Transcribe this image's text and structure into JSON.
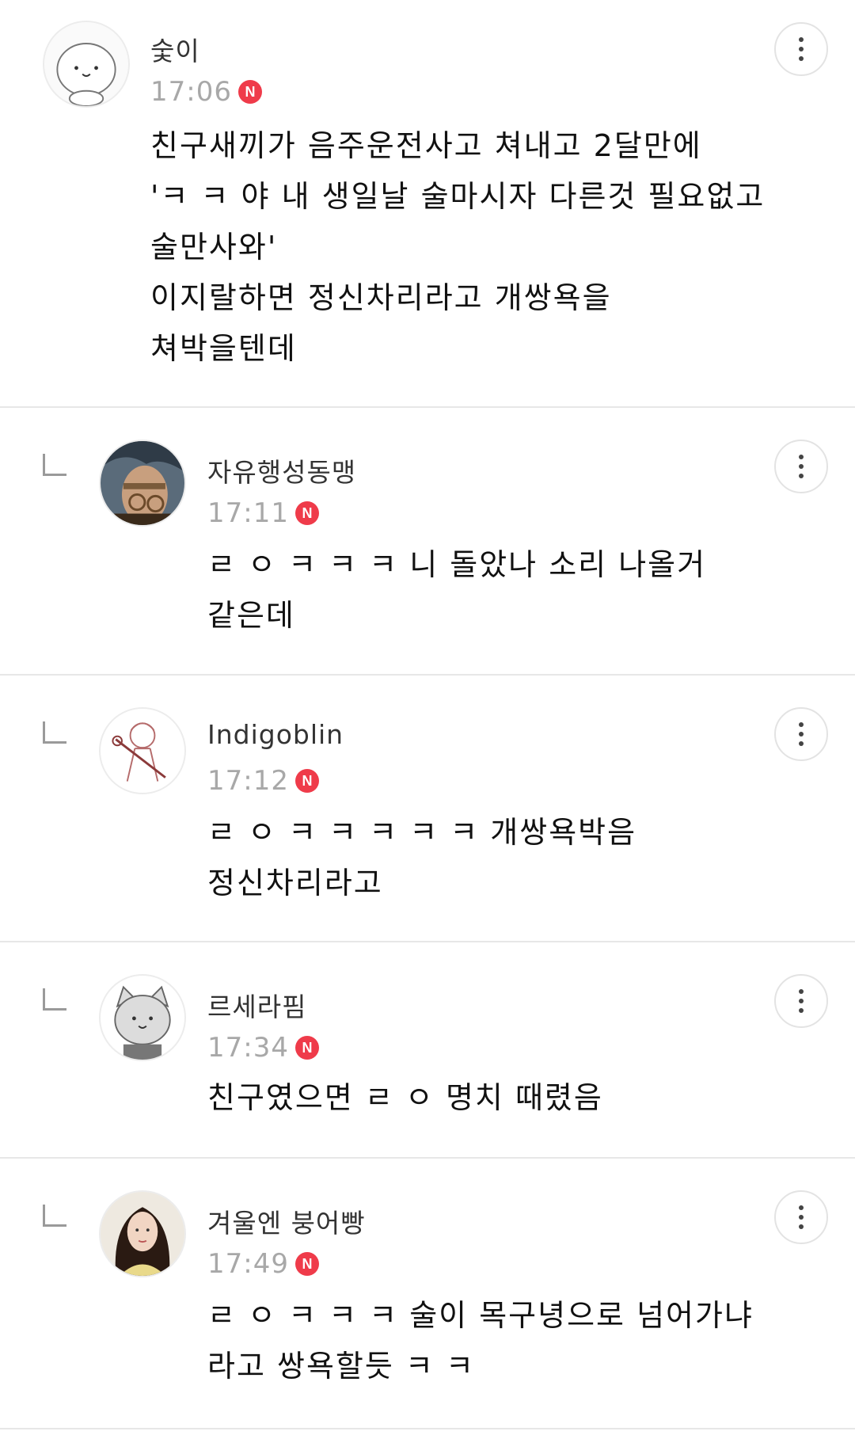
{
  "comments": [
    {
      "author": "숯이",
      "time": "17:06",
      "badge": "N",
      "avatar_icon": "cat-face-avatar",
      "lines": [
        "친구새끼가 음주운전사고 쳐내고 2달만에",
        "'ㅋ ㅋ 야 내 생일날 술마시자 다른것 필요없고",
        "술만사와'",
        "이지랄하면 정신차리라고 개쌍욕을",
        "쳐박을텐데"
      ]
    },
    {
      "author": "자유행성동맹",
      "time": "17:11",
      "badge": "N",
      "avatar_icon": "warrior-portrait-avatar",
      "lines": [
        "ㄹ ㅇ ㅋ ㅋ ㅋ 니 돌았나 소리 나올거",
        "같은데"
      ]
    },
    {
      "author": "Indigoblin",
      "time": "17:12",
      "badge": "N",
      "avatar_icon": "sketch-character-avatar",
      "lines": [
        "ㄹ ㅇ ㅋ ㅋ ㅋ ㅋ ㅋ 개쌍욕박음",
        "정신차리라고"
      ]
    },
    {
      "author": "르세라핌",
      "time": "17:34",
      "badge": "N",
      "avatar_icon": "gray-cat-avatar",
      "lines": [
        "친구였으면 ㄹ ㅇ 명치 때렸음"
      ]
    },
    {
      "author": "겨울엔 붕어빵",
      "time": "17:49",
      "badge": "N",
      "avatar_icon": "woman-portrait-avatar",
      "lines": [
        "ㄹ ㅇ ㅋ ㅋ ㅋ 술이 목구녕으로 넘어가냐",
        "라고 쌍욕할듯 ㅋ ㅋ"
      ]
    }
  ]
}
